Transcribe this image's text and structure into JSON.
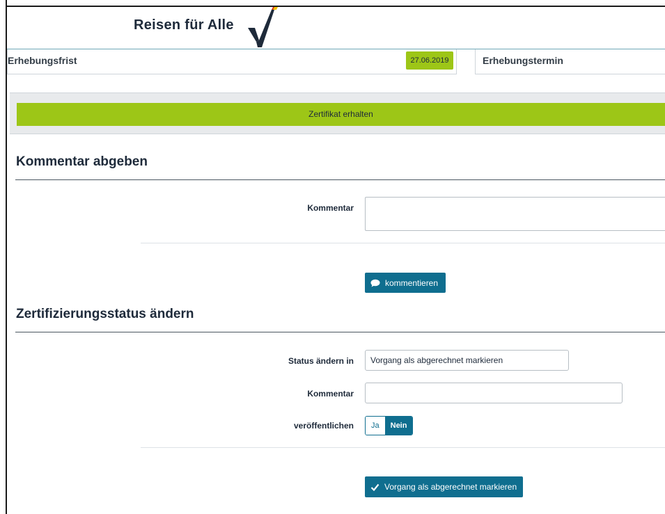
{
  "header": {
    "logo_text": "Reisen für Alle"
  },
  "info": {
    "erhebungsfrist_label": "Erhebungsfrist",
    "erhebungsfrist_date": "27.06.2019",
    "erhebungstermin_label": "Erhebungstermin"
  },
  "status": {
    "label": "Zertifikat erhalten",
    "color": "#9dc617"
  },
  "comment_section": {
    "title": "Kommentar abgeben",
    "comment_label": "Kommentar",
    "comment_value": "",
    "submit_label": "kommentieren",
    "submit_icon": "speech-bubble-icon"
  },
  "status_section": {
    "title": "Zertifizierungsstatus ändern",
    "status_label": "Status ändern in",
    "status_value": "Vorgang als abgerechnet markieren",
    "comment_label": "Kommentar",
    "comment_value": "",
    "publish_label": "veröffentlichen",
    "publish_options": [
      "Ja",
      "Nein"
    ],
    "publish_selected": "Nein",
    "submit_label": "Vorgang als abgerechnet markieren",
    "submit_icon": "checkmark-icon"
  },
  "colors": {
    "accent": "#0f6e8f",
    "status_green": "#9dc617",
    "text_dark": "#1e2a3a"
  }
}
